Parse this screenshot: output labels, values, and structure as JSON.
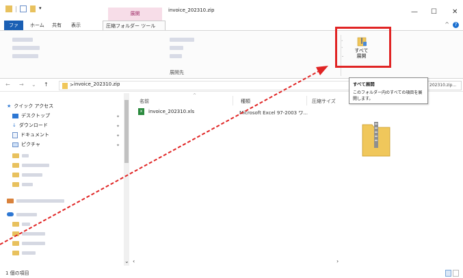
{
  "window": {
    "context_tab_header": "展開",
    "title": "invoice_202310.zip",
    "minimize": "—",
    "maximize": "☐",
    "close": "✕"
  },
  "tabs": {
    "file": "ファイル",
    "home": "ホーム",
    "share": "共有",
    "view": "表示",
    "compressed_tools": "圧縮フォルダー ツール",
    "help": "?",
    "collapse": "^"
  },
  "ribbon": {
    "group_label": "展開先",
    "extract_all_label": "すべて\n展開"
  },
  "address": {
    "back": "←",
    "forward": "→",
    "recent": "⌄",
    "up": "↑",
    "separator": ">",
    "path": "invoice_202310.zip",
    "search_value": "202310.zip..."
  },
  "nav": {
    "quick_access": "クイック アクセス",
    "items": [
      {
        "label": "デスクトップ",
        "icon": "desktop-icon"
      },
      {
        "label": "ダウンロード",
        "icon": "download-icon"
      },
      {
        "label": "ドキュメント",
        "icon": "document-icon"
      },
      {
        "label": "ピクチャ",
        "icon": "picture-icon"
      }
    ]
  },
  "content": {
    "columns": [
      "名前",
      "種類",
      "圧縮サイズ"
    ],
    "files": [
      {
        "name": "invoice_202310.xls",
        "type": "Microsoft Excel 97-2003 ワ..."
      }
    ]
  },
  "tooltip": {
    "title": "すべて展開",
    "body": "このフォルダー内のすべての項目を展開します。"
  },
  "status": {
    "count": "1 個の項目"
  },
  "colors": {
    "file_tab": "#1a5fb4",
    "highlight": "#e02424",
    "arrow": "#e02424",
    "context_tab": "#f7dde8"
  }
}
